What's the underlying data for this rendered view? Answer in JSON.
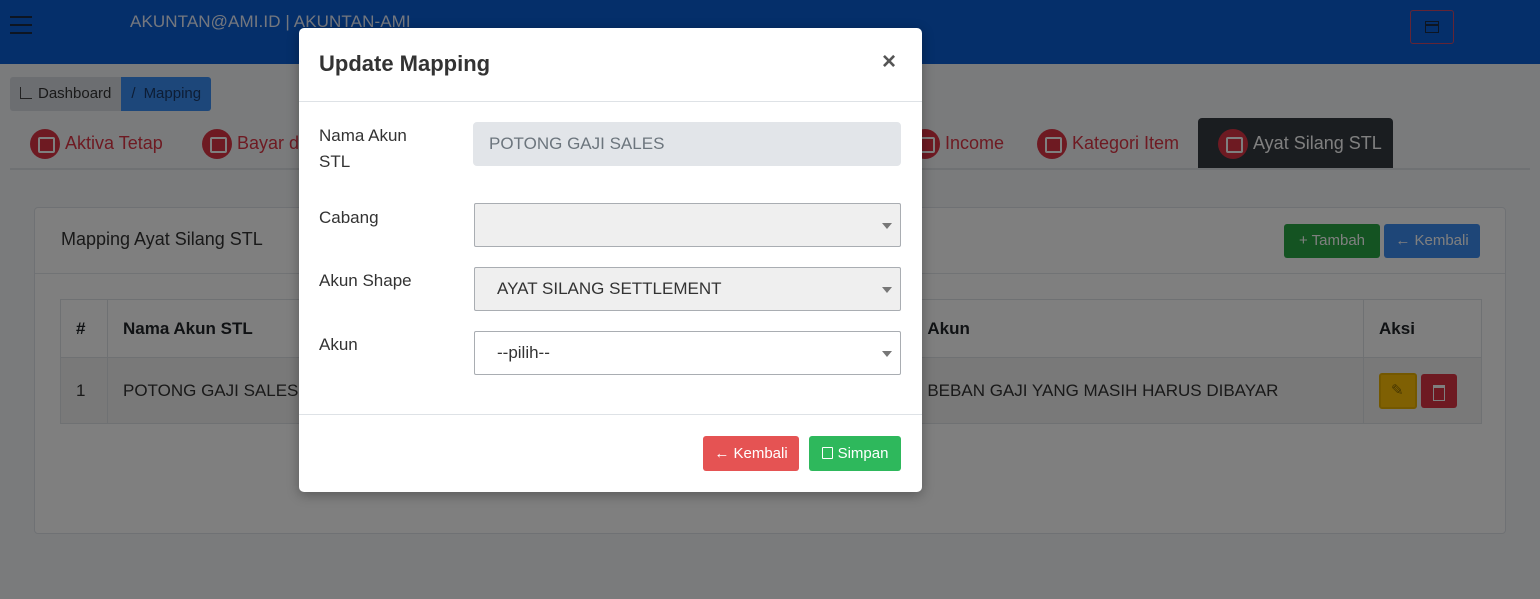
{
  "navbar": {
    "user_label": "AKUNTAN@AMI.ID | AKUNTAN-AMI"
  },
  "breadcrumb": {
    "dashboard": "Dashboard",
    "mapping": "Mapping",
    "separator": "/"
  },
  "tabs": [
    {
      "label": "Aktiva Tetap"
    },
    {
      "label": "Bayar di"
    },
    {
      "label": "Income"
    },
    {
      "label": "Kategori Item"
    },
    {
      "label": "Ayat Silang STL"
    }
  ],
  "card": {
    "title": "Mapping Ayat Silang STL",
    "add_label": "+ Tambah",
    "back_label": "← Kembali"
  },
  "table": {
    "headers": [
      "#",
      "Nama Akun STL",
      "Akun",
      "Aksi"
    ],
    "rows": [
      {
        "no": "1",
        "nama_akun_stl": "POTONG GAJI SALES",
        "akun": "BEBAN GAJI YANG MASIH HARUS DIBAYAR"
      }
    ]
  },
  "modal": {
    "title": "Update Mapping",
    "close": "×",
    "fields": {
      "nama_akun_label": "Nama Akun STL",
      "nama_akun_value": "POTONG GAJI SALES",
      "cabang_label": "Cabang",
      "cabang_value": "",
      "akun_shape_label": "Akun Shape",
      "akun_shape_value": "AYAT SILANG SETTLEMENT",
      "akun_label": "Akun",
      "akun_value": "--pilih--"
    },
    "back_label": "← Kembali",
    "save_label": "Simpan"
  },
  "colors": {
    "navbar": "#0b5fd4",
    "tab_text": "#dc3545",
    "tab_active_bg": "#343a40",
    "btn_green": "#28a745",
    "btn_blue": "#3d8cf0",
    "btn_red": "#e55353",
    "btn_yellow": "#ffc107"
  },
  "icons": {
    "menu": "hamburger-icon",
    "window": "window-icon",
    "tab": "wallet-icon",
    "edit": "pencil-icon",
    "delete": "trash-icon",
    "save": "floppy-icon"
  }
}
